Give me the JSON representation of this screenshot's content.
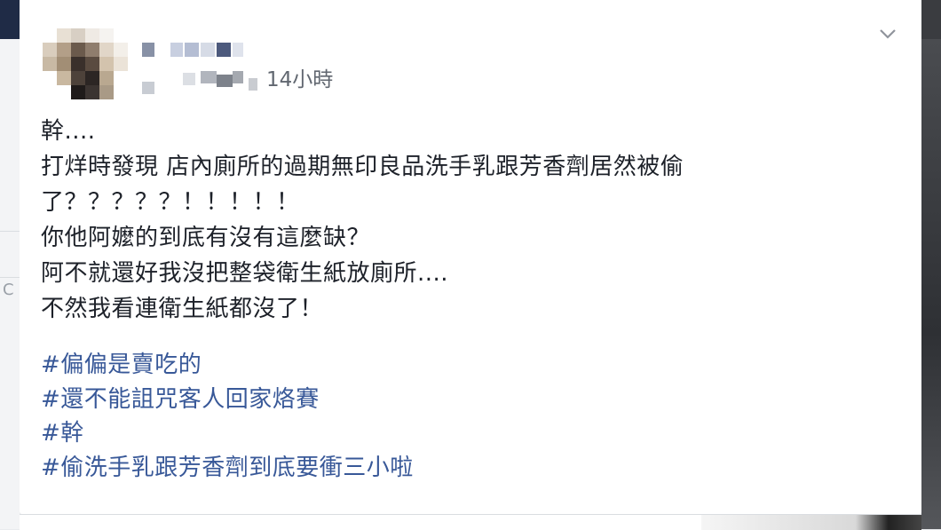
{
  "post": {
    "timestamp": "14小時",
    "body_lines": [
      "幹....",
      "打烊時發現 店內廁所的過期無印良品洗手乳跟芳香劑居然被偷",
      "了？？？？？！！！！！",
      "你他阿嬤的到底有沒有這麼缺？",
      "阿不就還好我沒把整袋衛生紙放廁所....",
      "不然我看連衛生紙都沒了！"
    ],
    "hashtags": [
      "#偏偏是賣吃的",
      "#還不能詛咒客人回家烙賽",
      "#幹",
      "#偷洗手乳跟芳香劑到底要衝三小啦"
    ],
    "options_icon": "chevron-down-icon",
    "link_color": "#385898",
    "text_color": "#1d2129",
    "meta_color": "#616770"
  }
}
